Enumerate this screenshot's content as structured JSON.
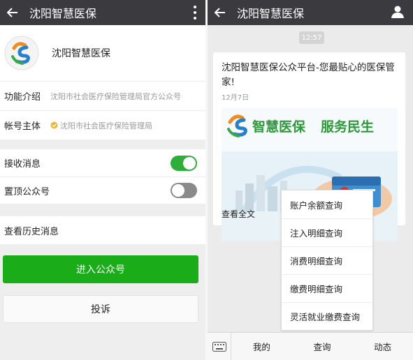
{
  "left": {
    "topbar": {
      "title": "沈阳智慧医保"
    },
    "profile": {
      "name": "沈阳智慧医保"
    },
    "info": [
      {
        "label": "功能介绍",
        "value": "沈阳市社会医疗保险管理局官方公众号"
      },
      {
        "label": "帐号主体",
        "value": "沈阳市社会医疗保险管理局"
      }
    ],
    "settings": [
      {
        "label": "接收消息",
        "enabled": true
      },
      {
        "label": "置顶公众号",
        "enabled": false
      }
    ],
    "history_label": "查看历史消息",
    "enter_button": "进入公众号",
    "report_button": "投诉"
  },
  "right": {
    "topbar": {
      "title": "沈阳智慧医保"
    },
    "timestamp": "12:57",
    "card": {
      "title": "沈阳智慧医保公众平台-您最贴心的医保管家!",
      "date": "12月7日",
      "banner_text_1": "智慧医保",
      "banner_text_2": "服务民生",
      "read_all": "查看全文"
    },
    "menu": [
      "账户余额查询",
      "注入明细查询",
      "消费明细查询",
      "缴费明细查询",
      "灵活就业缴费查询"
    ],
    "tabs": [
      "我的",
      "查询",
      "动态"
    ]
  },
  "colors": {
    "topbar": "#3a3a3f",
    "accent_green": "#1aad19",
    "toggle_on": "#2fae3a"
  }
}
